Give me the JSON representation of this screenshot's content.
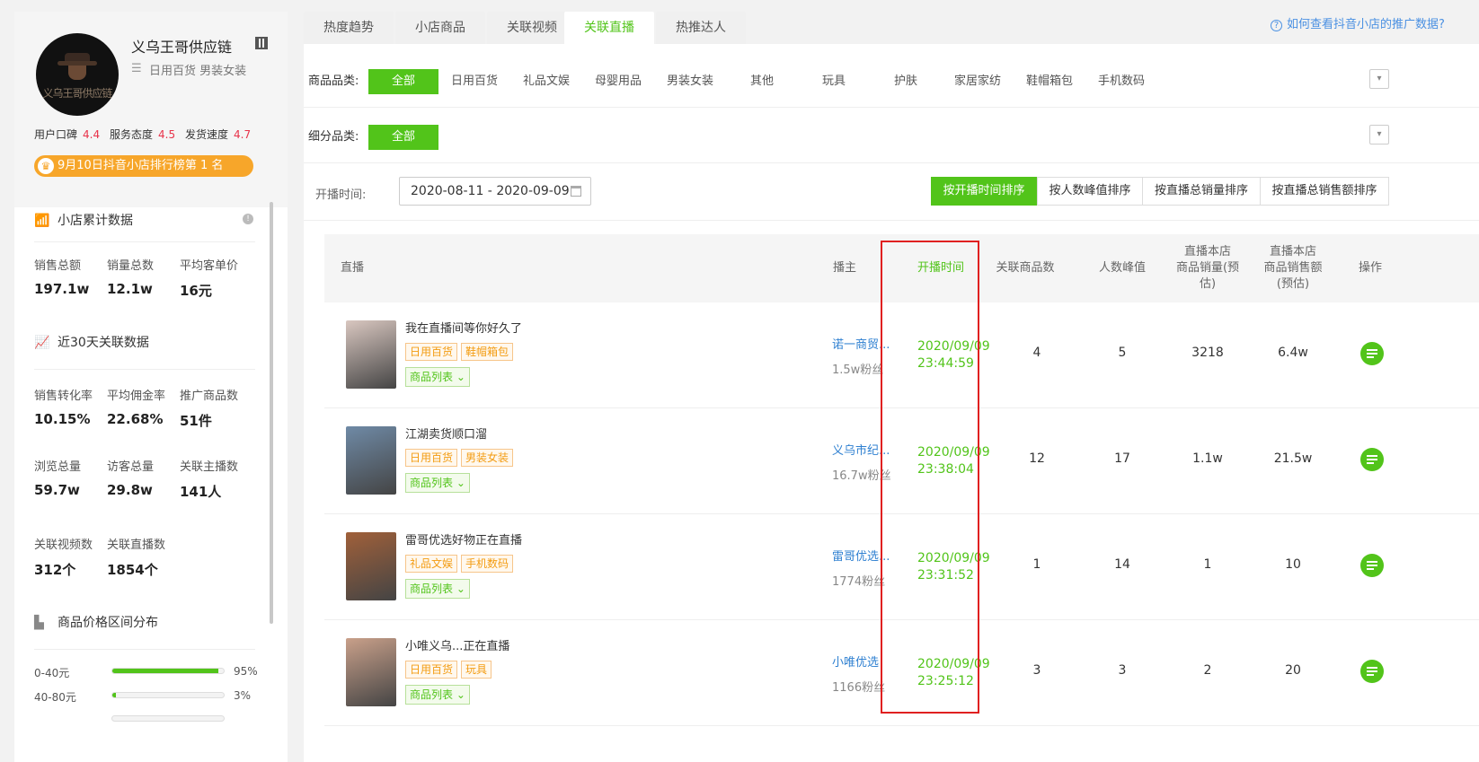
{
  "shop": {
    "name": "义乌王哥供应链",
    "categories": "日用百货 男装女装",
    "avatar_text": "义乌王哥供应链",
    "scores": [
      {
        "label": "用户口碑",
        "value": "4.4"
      },
      {
        "label": "服务态度",
        "value": "4.5"
      },
      {
        "label": "发货速度",
        "value": "4.7"
      }
    ],
    "rank_badge": "9月10日抖音小店排行榜第 1 名"
  },
  "cumulative": {
    "title": "小店累计数据",
    "stats": [
      {
        "label": "销售总额",
        "value": "197.1w"
      },
      {
        "label": "销量总数",
        "value": "12.1w"
      },
      {
        "label": "平均客单价",
        "value": "16元"
      }
    ]
  },
  "recent30": {
    "title": "近30天关联数据",
    "stats": [
      {
        "label": "销售转化率",
        "value": "10.15%"
      },
      {
        "label": "平均佣金率",
        "value": "22.68%"
      },
      {
        "label": "推广商品数",
        "value": "51件"
      },
      {
        "label": "浏览总量",
        "value": "59.7w"
      },
      {
        "label": "访客总量",
        "value": "29.8w"
      },
      {
        "label": "关联主播数",
        "value": "141人"
      },
      {
        "label": "关联视频数",
        "value": "312个"
      },
      {
        "label": "关联直播数",
        "value": "1854个"
      }
    ]
  },
  "price_dist": {
    "title": "商品价格区间分布",
    "rows": [
      {
        "label": "0-40元",
        "pct": "95%",
        "fraction": 0.95
      },
      {
        "label": "40-80元",
        "pct": "3%",
        "fraction": 0.03
      }
    ]
  },
  "tabs": [
    "热度趋势",
    "小店商品",
    "关联视频",
    "关联直播",
    "热推达人"
  ],
  "help_text": "如何查看抖音小店的推广数据?",
  "filters": {
    "category_label": "商品品类:",
    "categories": [
      "全部",
      "日用百货",
      "礼品文娱",
      "母婴用品",
      "男装女装",
      "其他",
      "玩具",
      "护肤",
      "家居家纺",
      "鞋帽箱包",
      "手机数码"
    ],
    "sub_label": "细分品类:",
    "sub_all": "全部",
    "date_label": "开播时间:",
    "date_range": "2020-08-11 - 2020-09-09",
    "sorts": [
      "按开播时间排序",
      "按人数峰值排序",
      "按直播总销量排序",
      "按直播总销售额排序"
    ]
  },
  "table": {
    "headers": {
      "live": "直播",
      "anchor": "播主",
      "start": "开播时间",
      "products": "关联商品数",
      "peak": "人数峰值",
      "sales_line1": "直播本店",
      "sales_line2": "商品销量(预",
      "sales_line3": "估)",
      "amount_line1": "直播本店",
      "amount_line2": "商品销售额",
      "amount_line3": "(预估)",
      "op": "操作"
    },
    "product_list_label": "商品列表",
    "rows": [
      {
        "title": "我在直播间等你好久了",
        "tags": [
          "日用百货",
          "鞋帽箱包"
        ],
        "anchor": "诺一商贸...",
        "fans": "1.5w粉丝",
        "date": "2020/09/09",
        "time": "23:44:59",
        "products": "4",
        "peak": "5",
        "sales": "3218",
        "amount": "6.4w",
        "thumb_color": "#d9c7c0"
      },
      {
        "title": "江湖卖货顺口溜",
        "tags": [
          "日用百货",
          "男装女装"
        ],
        "anchor": "义乌市纪...",
        "fans": "16.7w粉丝",
        "date": "2020/09/09",
        "time": "23:38:04",
        "products": "12",
        "peak": "17",
        "sales": "1.1w",
        "amount": "21.5w",
        "thumb_color": "#6f8aa6"
      },
      {
        "title": "雷哥优选好物正在直播",
        "tags": [
          "礼品文娱",
          "手机数码"
        ],
        "anchor": "雷哥优选...",
        "fans": "1774粉丝",
        "date": "2020/09/09",
        "time": "23:31:52",
        "products": "1",
        "peak": "14",
        "sales": "1",
        "amount": "10",
        "thumb_color": "#a0603a"
      },
      {
        "title": "小唯义乌...正在直播",
        "tags": [
          "日用百货",
          "玩具"
        ],
        "anchor": "小唯优选",
        "fans": "1166粉丝",
        "date": "2020/09/09",
        "time": "23:25:12",
        "products": "3",
        "peak": "3",
        "sales": "2",
        "amount": "20",
        "thumb_color": "#c9a08a"
      }
    ]
  }
}
